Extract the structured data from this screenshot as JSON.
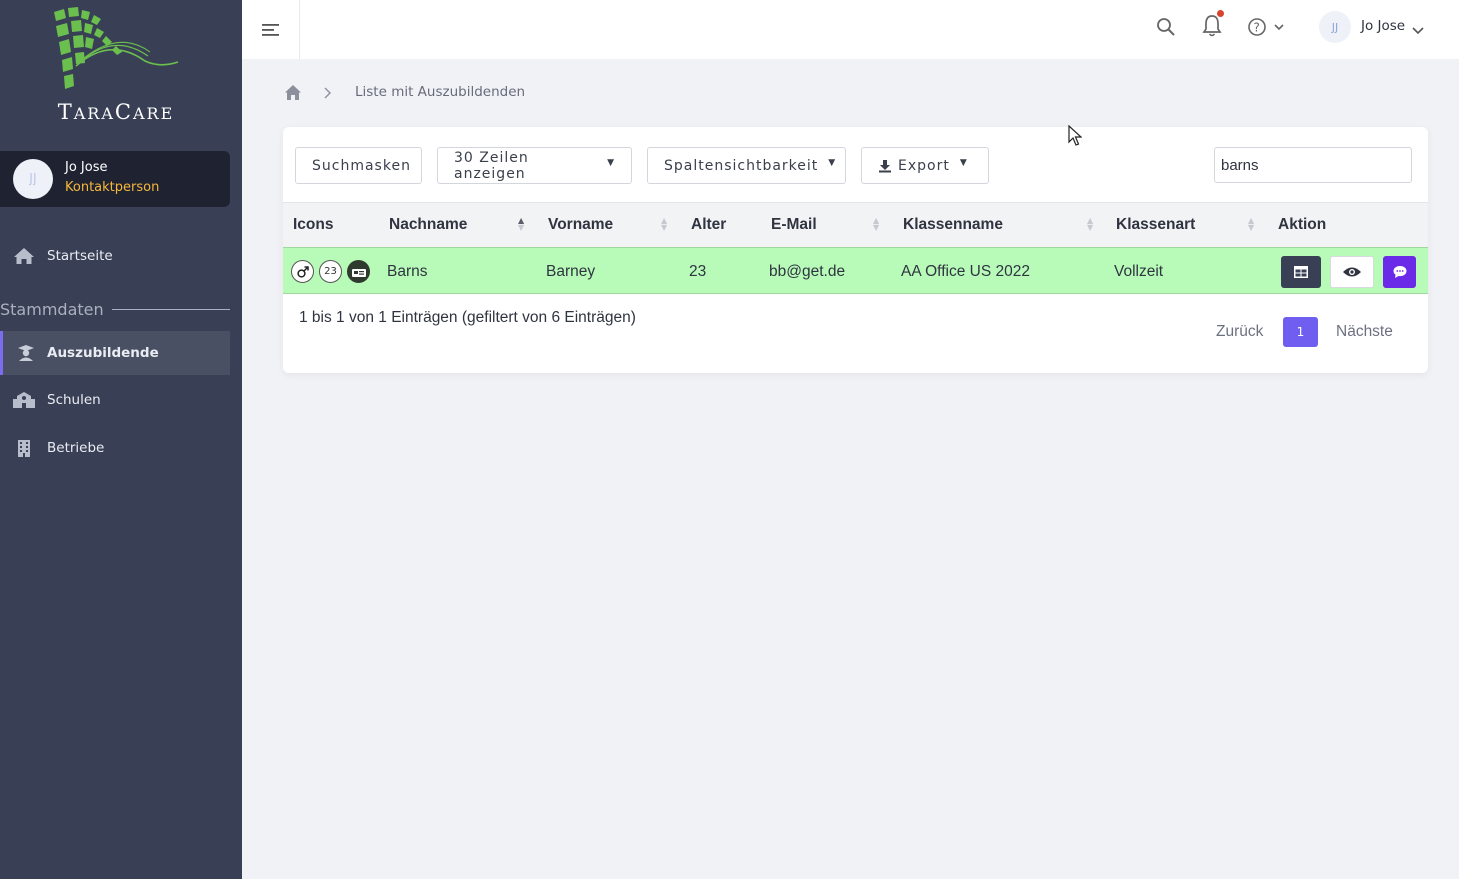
{
  "app": {
    "logo_text_big1": "T",
    "logo_text_small1": "ARA",
    "logo_text_big2": "C",
    "logo_text_small2": "ARE"
  },
  "sidebar": {
    "user": {
      "initials": "JJ",
      "name": "Jo Jose",
      "role": "Kontaktperson"
    },
    "items": [
      {
        "label": "Startseite",
        "icon": "home-icon"
      },
      {
        "label": "Auszubildende",
        "icon": "graduate-icon",
        "active": true
      },
      {
        "label": "Schulen",
        "icon": "school-icon"
      },
      {
        "label": "Betriebe",
        "icon": "building-icon"
      }
    ],
    "section_label": "Stammdaten"
  },
  "topbar": {
    "user_initials": "JJ",
    "user_name": "Jo Jose",
    "notification_color": "#d8432c"
  },
  "breadcrumb": {
    "current": "Liste mit Auszubildenden"
  },
  "toolbar": {
    "search_masks": "Suchmasken",
    "rows_select": "30 Zeilen anzeigen",
    "column_visibility": "Spaltensichtbarkeit",
    "export": "Export",
    "search_value": "barns"
  },
  "table": {
    "columns": [
      "Icons",
      "Nachname",
      "Vorname",
      "Alter",
      "E-Mail",
      "Klassenname",
      "Klassenart",
      "Aktion"
    ],
    "rows": [
      {
        "age_badge": "23",
        "nachname": "Barns",
        "vorname": "Barney",
        "alter": "23",
        "email": "bb@get.de",
        "klassenname": "AA Office US 2022",
        "klassenart": "Vollzeit",
        "row_color": "#b8fbb8"
      }
    ],
    "info": "1 bis 1 von 1 Einträgen (gefiltert von 6 Einträgen)"
  },
  "pagination": {
    "prev": "Zurück",
    "current": "1",
    "next": "Nächste"
  },
  "colors": {
    "sidebar": "#394055",
    "accent": "#6f5ef0",
    "row_highlight": "#b8fbb8"
  }
}
